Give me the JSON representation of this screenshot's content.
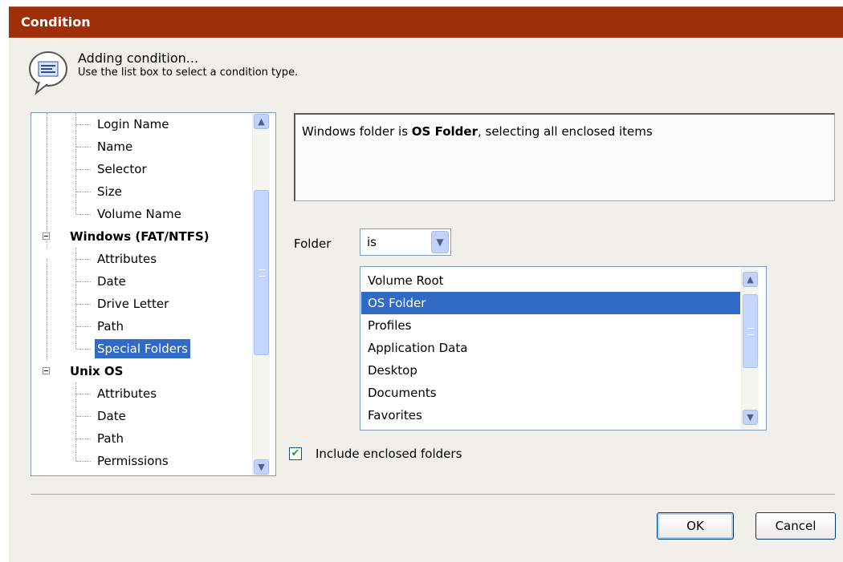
{
  "window": {
    "title": "Condition"
  },
  "header": {
    "icon": "speech-bubble-icon",
    "line1": "Adding condition...",
    "line2": "Use the list box to select a condition type."
  },
  "tree": {
    "items": [
      {
        "label": "Login Name",
        "type": "child"
      },
      {
        "label": "Name",
        "type": "child"
      },
      {
        "label": "Selector",
        "type": "child"
      },
      {
        "label": "Size",
        "type": "child"
      },
      {
        "label": "Volume Name",
        "type": "child"
      },
      {
        "label": "Windows (FAT/NTFS)",
        "type": "parent"
      },
      {
        "label": "Attributes",
        "type": "child"
      },
      {
        "label": "Date",
        "type": "child"
      },
      {
        "label": "Drive Letter",
        "type": "child"
      },
      {
        "label": "Path",
        "type": "child"
      },
      {
        "label": "Special Folders",
        "type": "child",
        "selected": true
      },
      {
        "label": "Unix OS",
        "type": "parent"
      },
      {
        "label": "Attributes",
        "type": "child"
      },
      {
        "label": "Date",
        "type": "child"
      },
      {
        "label": "Path",
        "type": "child"
      },
      {
        "label": "Permissions",
        "type": "child"
      }
    ]
  },
  "description": {
    "prefix": "Windows folder is ",
    "value": "OS Folder",
    "suffix": ", selecting all enclosed items"
  },
  "folder": {
    "label": "Folder",
    "operator": "is",
    "options": [
      {
        "label": "Volume Root"
      },
      {
        "label": "OS Folder",
        "selected": true
      },
      {
        "label": "Profiles"
      },
      {
        "label": "Application Data"
      },
      {
        "label": "Desktop"
      },
      {
        "label": "Documents"
      },
      {
        "label": "Favorites"
      }
    ]
  },
  "include_enclosed": {
    "label": "Include enclosed folders",
    "checked": true
  },
  "buttons": {
    "ok": "OK",
    "cancel": "Cancel"
  },
  "colors": {
    "titlebar": "#9f2f08",
    "selection": "#316ac5",
    "dialog_bg": "#f0efe9"
  }
}
